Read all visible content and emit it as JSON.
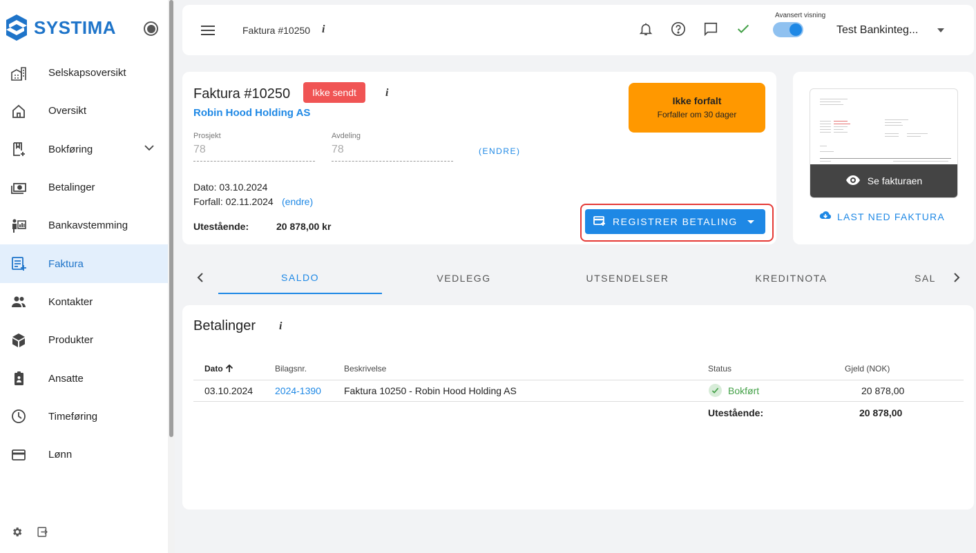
{
  "brand": {
    "name": "SYSTIMA",
    "accent": "#1e88e5",
    "status_warning": "#ff9800",
    "status_error": "#f05454",
    "status_ok": "#43a047"
  },
  "sidebar": {
    "items": [
      {
        "label": "Selskapsoversikt",
        "icon": "buildings-icon"
      },
      {
        "label": "Oversikt",
        "icon": "home-icon"
      },
      {
        "label": "Bokføring",
        "icon": "bookmark-add-icon"
      },
      {
        "label": "Betalinger",
        "icon": "money-icon"
      },
      {
        "label": "Bankavstemming",
        "icon": "bank-reconcile-icon"
      },
      {
        "label": "Faktura",
        "icon": "invoice-add-icon",
        "active": true
      },
      {
        "label": "Kontakter",
        "icon": "people-icon"
      },
      {
        "label": "Produkter",
        "icon": "box-icon"
      },
      {
        "label": "Ansatte",
        "icon": "badge-icon"
      },
      {
        "label": "Timeføring",
        "icon": "clock-icon"
      },
      {
        "label": "Lønn",
        "icon": "card-icon"
      }
    ]
  },
  "topbar": {
    "title": "Faktura #10250",
    "info": "i",
    "advanced_label": "Avansert visning",
    "company": "Test Bankinteg..."
  },
  "invoice": {
    "title": "Faktura #10250",
    "badge": "Ikke sendt",
    "info": "i",
    "customer": "Robin Hood Holding AS",
    "project_label": "Prosjekt",
    "project_value": "78",
    "department_label": "Avdeling",
    "department_value": "78",
    "change_caps": "(ENDRE)",
    "date_text": "Dato: 03.10.2024",
    "due_text": "Forfall: 02.11.2024",
    "change_link": "(endre)",
    "outstanding_label": "Utestående:",
    "outstanding_value": "20 878,00 kr",
    "status_title": "Ikke forfalt",
    "status_sub": "Forfaller om 30 dager",
    "register_button": "REGISTRER BETALING"
  },
  "preview": {
    "view_label": "Se fakturaen",
    "download_label": "LAST NED FAKTURA"
  },
  "tabs": [
    "SALDO",
    "VEDLEGG",
    "UTSENDELSER",
    "KREDITNOTA",
    "SAL"
  ],
  "payments": {
    "title": "Betalinger",
    "info": "i",
    "columns": {
      "date": "Dato",
      "voucher": "Bilagsnr.",
      "description": "Beskrivelse",
      "status": "Status",
      "debt": "Gjeld (NOK)"
    },
    "rows": [
      {
        "date": "03.10.2024",
        "voucher": "2024-1390",
        "description": "Faktura 10250 - Robin Hood Holding AS",
        "status": "Bokført",
        "debt": "20 878,00"
      }
    ],
    "footer_label": "Utestående:",
    "footer_value": "20 878,00"
  }
}
